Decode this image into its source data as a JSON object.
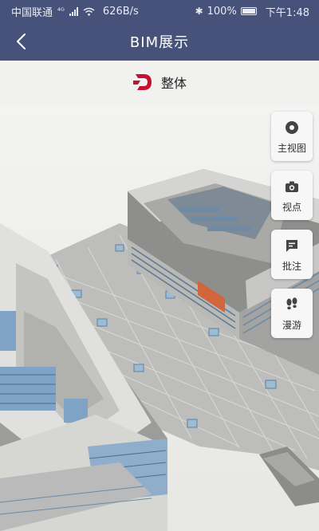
{
  "status_bar": {
    "carrier": "中国联通",
    "network_marker": "⁴ᴳ",
    "speed": "626B/s",
    "bluetooth": "✱",
    "battery": "100%",
    "time": "下午1:48"
  },
  "nav": {
    "back_icon": "chevron-left-icon",
    "title": "BIM展示"
  },
  "sub_header": {
    "logo_letter": "D",
    "logo_color": "#c8102e",
    "title": "整体"
  },
  "tools": [
    {
      "label": "主视图",
      "icon": "disc-icon"
    },
    {
      "label": "视点",
      "icon": "camera-icon"
    },
    {
      "label": "批注",
      "icon": "comment-icon"
    },
    {
      "label": "漫游",
      "icon": "footprints-icon"
    }
  ],
  "colors": {
    "header_bg": "#46527a",
    "accent_red": "#c8102e",
    "building_orange": "#d2653c",
    "glass_blue": "#7fa3c4"
  }
}
